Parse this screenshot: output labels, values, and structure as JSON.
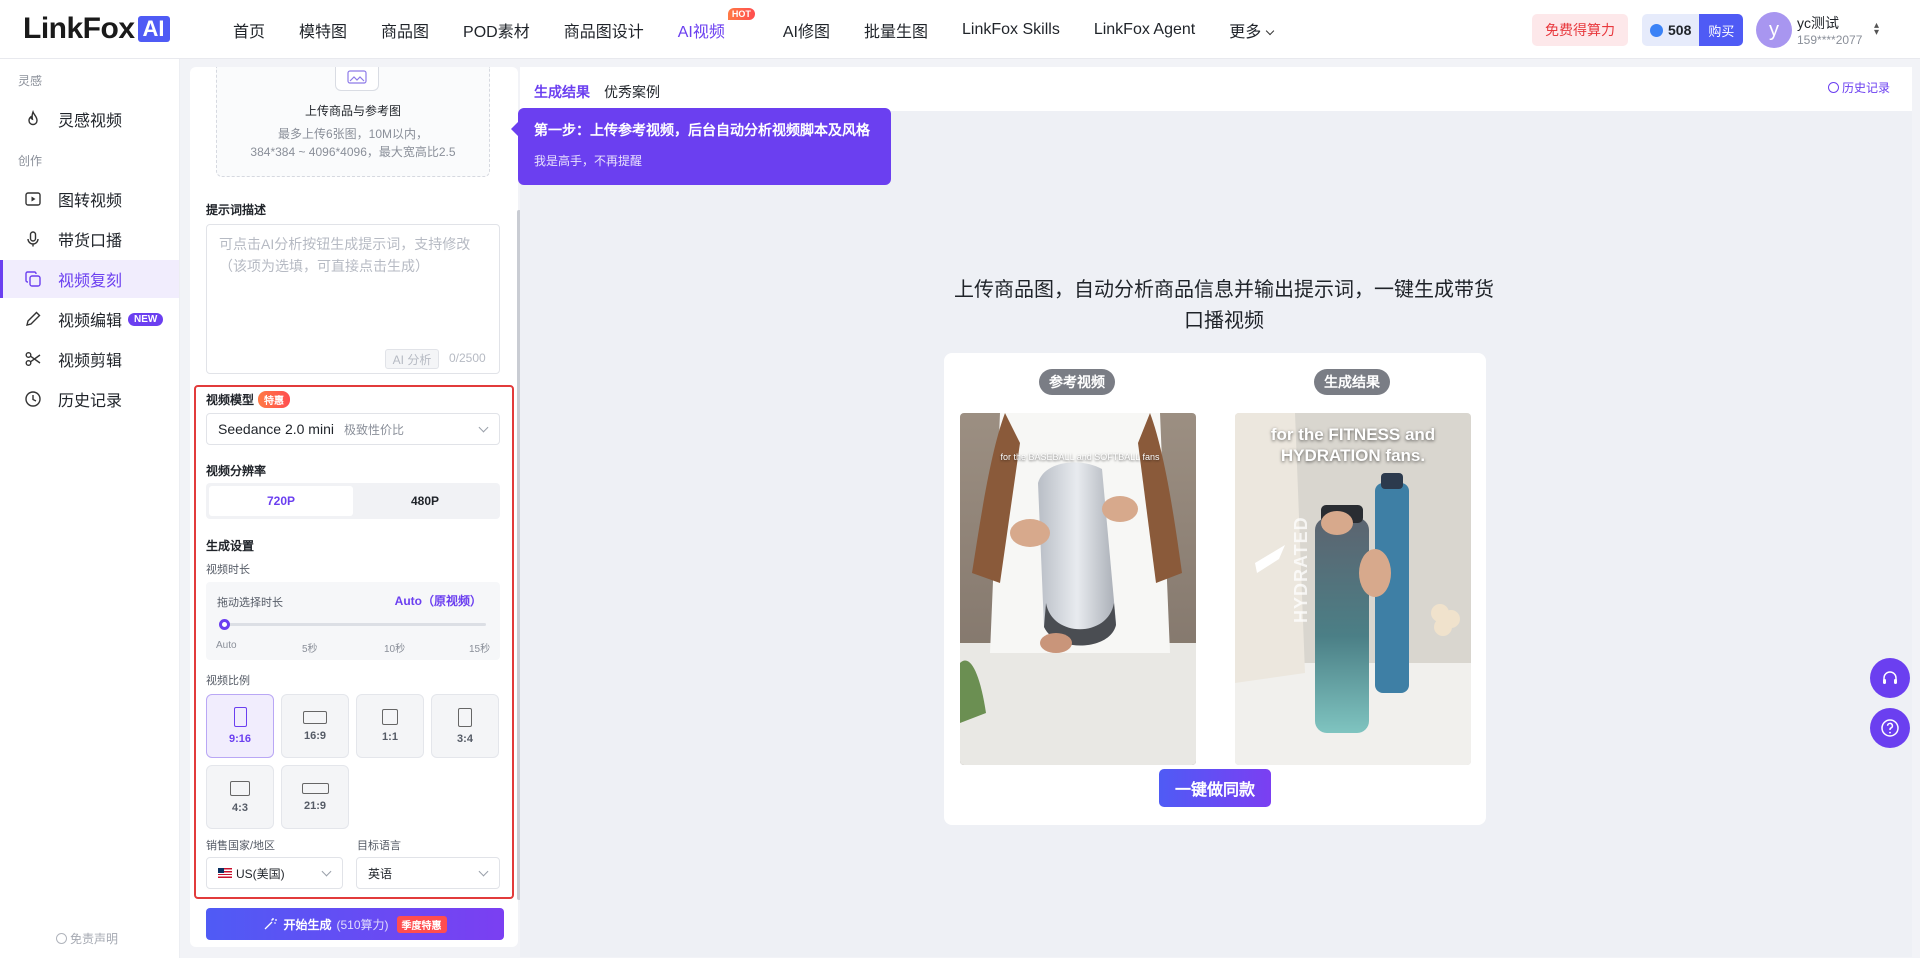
{
  "brand": {
    "logo_text": "LinkFox",
    "logo_ai": "AI"
  },
  "nav": {
    "items": [
      {
        "label": "首页"
      },
      {
        "label": "模特图"
      },
      {
        "label": "商品图"
      },
      {
        "label": "POD素材"
      },
      {
        "label": "商品图设计"
      },
      {
        "label": "AI视频",
        "badge": "HOT"
      },
      {
        "label": "AI修图"
      },
      {
        "label": "批量生图"
      },
      {
        "label": "LinkFox Skills"
      },
      {
        "label": "LinkFox Agent"
      },
      {
        "label": "更多"
      }
    ],
    "free_credits_label": "免费得算力",
    "credits_value": "508",
    "buy_label": "购买",
    "user": {
      "avatar_letter": "y",
      "name": "yc测试",
      "phone": "159****2077"
    }
  },
  "sidebar": {
    "section_inspiration": "灵感",
    "section_create": "创作",
    "items": [
      {
        "label": "灵感视频"
      },
      {
        "label": "图转视频"
      },
      {
        "label": "带货口播"
      },
      {
        "label": "视频复刻"
      },
      {
        "label": "视频编辑",
        "badge": "NEW"
      },
      {
        "label": "视频剪辑"
      },
      {
        "label": "历史记录"
      }
    ],
    "disclaimer": "免责声明"
  },
  "config": {
    "upload": {
      "title": "上传商品与参考图",
      "line1": "最多上传6张图，10M以内，",
      "line2": "384*384 ~ 4096*4096，最大宽高比2.5"
    },
    "prompt": {
      "label": "提示词描述",
      "placeholder": "可点击AI分析按钮生成提示词，支持修改（该项为选填，可直接点击生成）",
      "ai_button": "AI 分析",
      "counter": "0/2500"
    },
    "model": {
      "label": "视频模型",
      "badge": "特惠",
      "value": "Seedance 2.0 mini",
      "tag": "极致性价比"
    },
    "resolution": {
      "label": "视频分辨率",
      "options": [
        "720P",
        "480P"
      ],
      "selected": "720P"
    },
    "generation": {
      "label": "生成设置",
      "duration_label": "视频时长",
      "duration_hint": "拖动选择时长",
      "duration_value": "Auto（原视频）",
      "ticks": [
        "Auto",
        "5秒",
        "10秒",
        "15秒"
      ],
      "ratio_label": "视频比例",
      "ratios": [
        "9:16",
        "16:9",
        "1:1",
        "3:4",
        "4:3",
        "21:9"
      ],
      "selected_ratio": "9:16"
    },
    "region": {
      "label": "销售国家/地区",
      "value": "US(美国)"
    },
    "language": {
      "label": "目标语言",
      "value": "英语"
    },
    "generate": {
      "label": "开始生成",
      "cost": "(510算力)",
      "badge": "季度特惠"
    }
  },
  "results": {
    "tabs": [
      "生成结果",
      "优秀案例"
    ],
    "history_label": "历史记录",
    "tooltip": {
      "title": "第一步：上传参考视频，后台自动分析视频脚本及风格",
      "dismiss": "我是高手，不再提醒"
    },
    "headline": "上传商品图，自动分析商品信息并输出提示词，一键生成带货口播视频",
    "demo": {
      "reference_label": "参考视频",
      "result_label": "生成结果",
      "reference_caption": "for the BASEBALL and SOFTBALL fans",
      "result_caption_1": "for the FITNESS and",
      "result_caption_2": "HYDRATION fans.",
      "bottle_text": "HYDRATED",
      "make_button": "一键做同款"
    }
  },
  "colors": {
    "accent": "#6b3ff0",
    "brand_blue": "#4f5bf5",
    "highlight_frame": "#e23b3b"
  }
}
